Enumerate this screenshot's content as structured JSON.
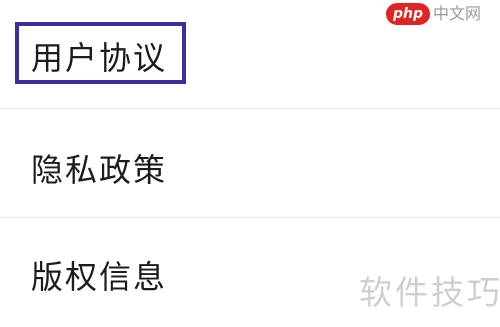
{
  "menu": {
    "items": [
      {
        "label": "用户协议",
        "highlighted": true
      },
      {
        "label": "隐私政策"
      },
      {
        "label": "版权信息"
      }
    ]
  },
  "logo": {
    "badge": "php",
    "text": "中文网"
  },
  "watermark": {
    "text": "软件技巧"
  },
  "colors": {
    "highlight_border": "#3f2ca1",
    "badge_red": "#e02424",
    "divider": "#e6e6e6"
  }
}
